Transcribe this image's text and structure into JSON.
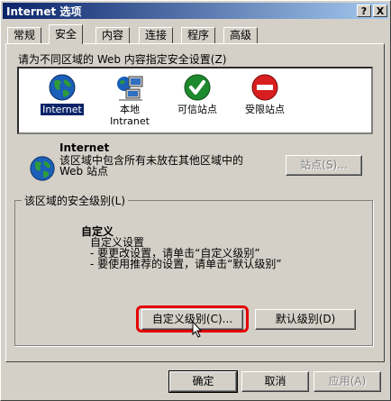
{
  "window": {
    "title": "Internet 选项",
    "help_label": "?",
    "close_label": "X"
  },
  "tabs": [
    {
      "label": "常规"
    },
    {
      "label": "安全"
    },
    {
      "label": "内容"
    },
    {
      "label": "连接"
    },
    {
      "label": "程序"
    },
    {
      "label": "高级"
    }
  ],
  "zones": {
    "prompt": "请为不同区域的 Web 内容指定安全设置(Z)",
    "items": [
      {
        "label": "Internet",
        "icon": "globe-icon",
        "selected": true
      },
      {
        "label": "本地\nIntranet",
        "icon": "intranet-icon"
      },
      {
        "label": "可信站点",
        "icon": "check-icon"
      },
      {
        "label": "受限站点",
        "icon": "restricted-icon"
      }
    ]
  },
  "zone_info": {
    "title": "Internet",
    "description": "该区域中包含所有未放在其他区域中的 Web 站点",
    "sites_button": "站点(S)..."
  },
  "security_level": {
    "group_label": "该区域的安全级别(L)",
    "level_title": "自定义",
    "lines": [
      "自定义设置",
      "- 要更改设置，请单击“自定义级别”",
      "- 要使用推荐的设置，请单击“默认级别”"
    ],
    "custom_button": "自定义级别(C)...",
    "default_button": "默认级别(D)"
  },
  "footer": {
    "ok": "确定",
    "cancel": "取消",
    "apply": "应用(A)"
  },
  "colors": {
    "titlebar": "#0a246a",
    "highlight_outline": "#e30000"
  }
}
